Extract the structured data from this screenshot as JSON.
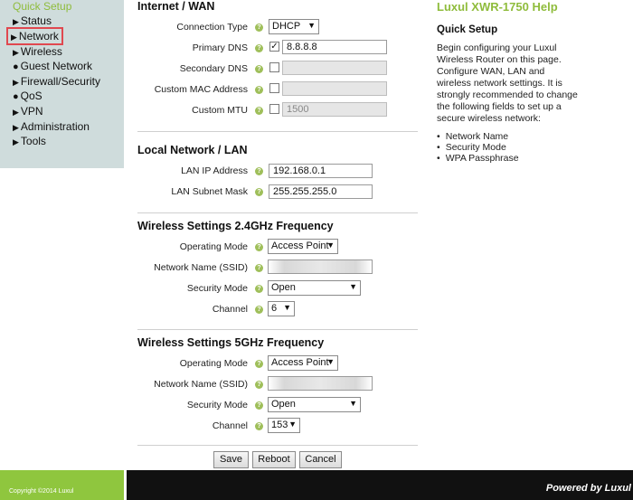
{
  "sidebar": {
    "quick_setup": "Quick Setup",
    "items": [
      {
        "label": "Status",
        "prefix": "▶"
      },
      {
        "label": "Network",
        "prefix": "▶"
      },
      {
        "label": "Wireless",
        "prefix": "▶"
      },
      {
        "label": "Guest Network",
        "prefix": "●"
      },
      {
        "label": "Firewall/Security",
        "prefix": "▶"
      },
      {
        "label": "QoS",
        "prefix": "●"
      },
      {
        "label": "VPN",
        "prefix": "▶"
      },
      {
        "label": "Administration",
        "prefix": "▶"
      },
      {
        "label": "Tools",
        "prefix": "▶"
      }
    ]
  },
  "wan": {
    "title": "Internet / WAN",
    "connection_type_label": "Connection Type",
    "connection_type_value": "DHCP",
    "primary_dns_label": "Primary DNS",
    "primary_dns_checked": "✓",
    "primary_dns_value": "8.8.8.8",
    "secondary_dns_label": "Secondary DNS",
    "custom_mac_label": "Custom MAC Address",
    "custom_mtu_label": "Custom MTU",
    "custom_mtu_value": "1500"
  },
  "lan": {
    "title": "Local Network / LAN",
    "ip_label": "LAN IP Address",
    "ip_value": "192.168.0.1",
    "mask_label": "LAN Subnet Mask",
    "mask_value": "255.255.255.0"
  },
  "wifi24": {
    "title": "Wireless Settings 2.4GHz Frequency",
    "mode_label": "Operating Mode",
    "mode_value": "Access Point",
    "ssid_label": "Network Name (SSID)",
    "security_label": "Security Mode",
    "security_value": "Open",
    "channel_label": "Channel",
    "channel_value": "6"
  },
  "wifi5": {
    "title": "Wireless Settings 5GHz Frequency",
    "mode_label": "Operating Mode",
    "mode_value": "Access Point",
    "ssid_label": "Network Name (SSID)",
    "security_label": "Security Mode",
    "security_value": "Open",
    "channel_label": "Channel",
    "channel_value": "153"
  },
  "buttons": {
    "save": "Save",
    "reboot": "Reboot",
    "cancel": "Cancel"
  },
  "help": {
    "title": "Luxul XWR-1750 Help",
    "subtitle": "Quick Setup",
    "body": "Begin configuring your Luxul Wireless Router on this page. Configure WAN, LAN and wireless network settings. It is strongly recommended to change the following fields to set up a secure wireless network:",
    "items": [
      "Network Name",
      "Security Mode",
      "WPA Passphrase"
    ]
  },
  "footer": {
    "copyright": "Copyright ©2014 Luxul",
    "powered": "Powered by Luxul"
  },
  "colors": {
    "accent_green": "#8fbc3c",
    "sidebar_bg": "#cfdcdc",
    "selected_outline": "#e0484f",
    "footer_dark": "#111111"
  }
}
